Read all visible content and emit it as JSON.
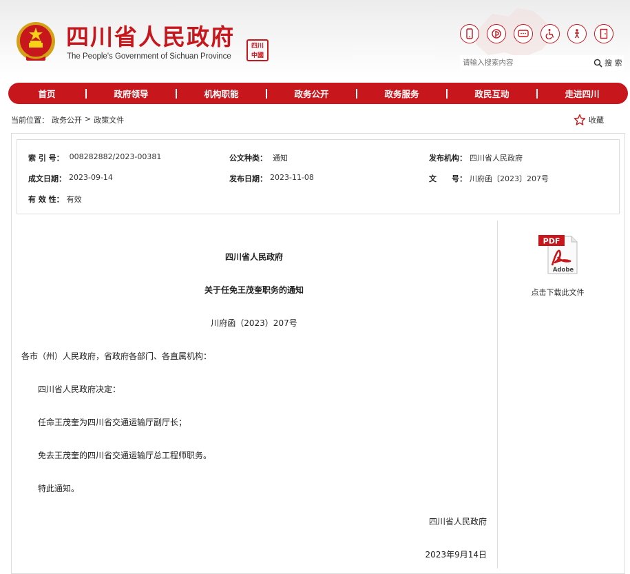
{
  "header": {
    "title_cn": "四川省人民政府",
    "title_en": "The People's Government of Sichuan Province",
    "seal_text": "四川\n中國",
    "icons": [
      "mobile-icon",
      "weibo-icon",
      "wechat-icon",
      "accessibility-icon",
      "elderly-care-icon",
      "exit-icon"
    ],
    "search_placeholder": "请输入搜索内容",
    "search_button": "搜 索"
  },
  "nav": {
    "items": [
      "首页",
      "政府领导",
      "机构职能",
      "政务公开",
      "政务服务",
      "政民互动",
      "走进四川"
    ]
  },
  "breadcrumb": {
    "prefix": "当前位置：",
    "level1": "政务公开",
    "sep": ">",
    "level2": "政策文件"
  },
  "favorite_label": "收藏",
  "meta": {
    "index_label": "索 引 号：",
    "index_value": "008282882/2023-00381",
    "category_label": "公文种类：",
    "category_value": "通知",
    "issuer_label": "发布机构：",
    "issuer_value": "四川省人民政府",
    "created_label": "成文日期：",
    "created_value": "2023-09-14",
    "published_label": "发布日期：",
    "published_value": "2023-11-08",
    "docno_label": "文　　号：",
    "docno_value": "川府函〔2023〕207号",
    "validity_label": "有 效 性：",
    "validity_value": "有效"
  },
  "document": {
    "org": "四川省人民政府",
    "title": "关于任免王茂奎职务的通知",
    "docno": "川府函（2023）207号",
    "recipients": "各市（州）人民政府，省政府各部门、各直属机构：",
    "paragraphs": [
      "四川省人民政府决定：",
      "任命王茂奎为四川省交通运输厅副厅长；",
      "免去王茂奎的四川省交通运输厅总工程师职务。",
      "特此通知。"
    ],
    "signature": "四川省人民政府",
    "date": "2023年9月14日"
  },
  "download": {
    "pdf_badge": "PDF",
    "adobe_text": "Adobe",
    "label": "点击下载此文件"
  },
  "colors": {
    "brand_red": "#c8161d"
  }
}
